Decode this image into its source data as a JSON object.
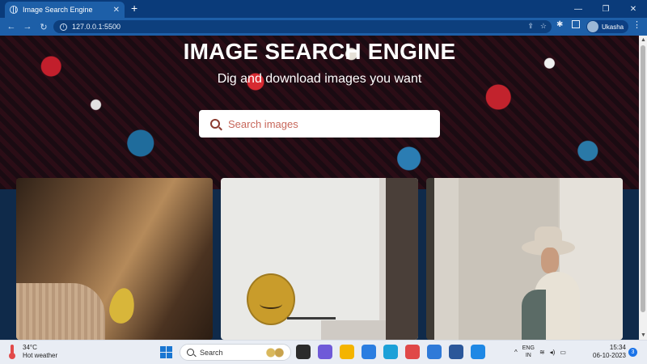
{
  "browser": {
    "tab_title": "Image Search Engine",
    "tab_close": "✕",
    "new_tab": "+",
    "url": "127.0.0.1:5500",
    "profile_name": "Ukasha",
    "window_controls": [
      "—",
      "❐",
      "✕"
    ]
  },
  "hero": {
    "title": "IMAGE SEARCH ENGINE",
    "subtitle": "Dig and download images you want",
    "search_placeholder": "Search images"
  },
  "gallery": {
    "images": [
      {
        "icon": "hair-leaf-photo"
      },
      {
        "icon": "satellite-dish-photo"
      },
      {
        "icon": "woman-hat-photo"
      }
    ]
  },
  "taskbar": {
    "weather_temp": "34°C",
    "weather_desc": "Hot weather",
    "search_label": "Search",
    "lang_top": "ENG",
    "lang_bottom": "IN",
    "time": "15:34",
    "date": "06-10-2023",
    "notification_count": "3",
    "app_colors": [
      "#2b2b2b",
      "#6f5ad8",
      "#f4b400",
      "#2a7de1",
      "#1ba0d8",
      "#e04848",
      "#2f7ad8",
      "#2b579a",
      "#1e88e5"
    ]
  }
}
